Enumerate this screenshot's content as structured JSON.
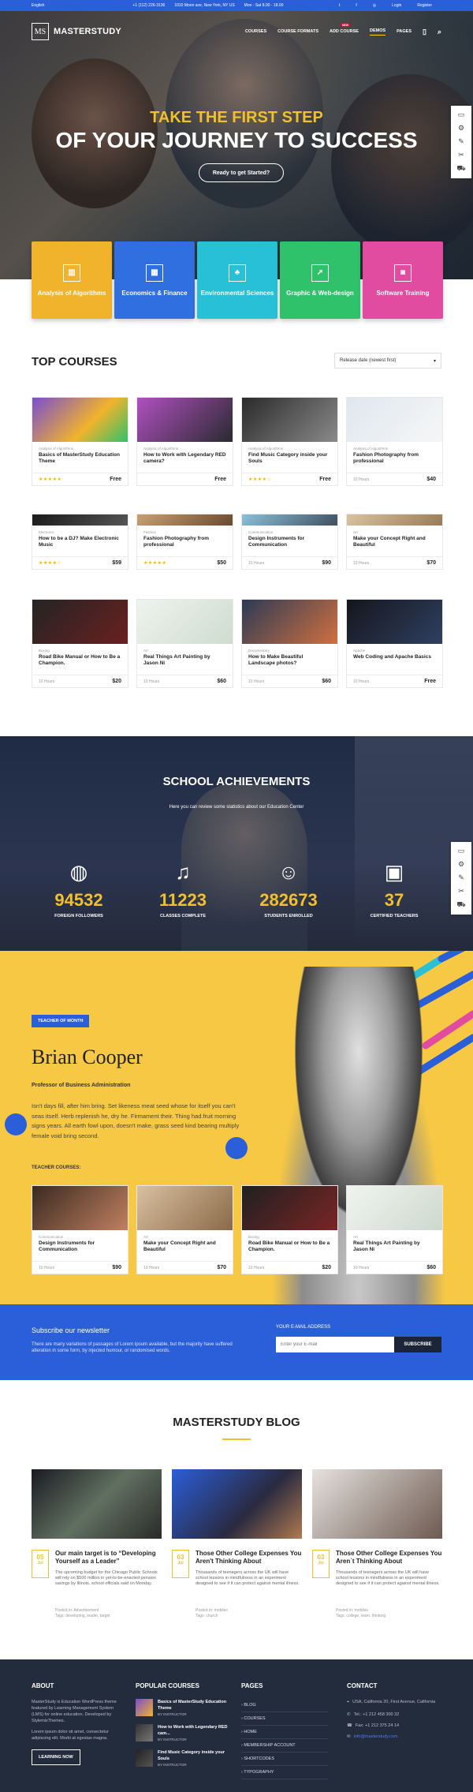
{
  "topbar": {
    "language": "English",
    "phone": "+1 (112) 226-3136",
    "address": "1010 Moon ave, New York, NY US",
    "hours": "Mon - Sat 8.00 - 18.00",
    "login": "Login",
    "register": "Register"
  },
  "brand": {
    "logo": "MS",
    "name": "MASTERSTUDY"
  },
  "nav": {
    "courses": "COURSES",
    "formats": "COURSE FORMATS",
    "add": "ADD COURSE",
    "new_tag": "NEW",
    "demos": "DEMOS",
    "pages": "PAGES"
  },
  "hero": {
    "line1": "TAKE THE FIRST STEP",
    "line2": "OF YOUR JOURNEY TO SUCCESS",
    "button": "Ready to get Started?"
  },
  "categories": [
    {
      "label": "Analysis of Algorithms",
      "color": "#f1b32c",
      "icon": "chart-icon"
    },
    {
      "label": "Economics & Finance",
      "color": "#2f6fe0",
      "icon": "grid-icon"
    },
    {
      "label": "Environmental Sciences",
      "color": "#28c0d6",
      "icon": "tree-icon"
    },
    {
      "label": "Graphic & Web-design",
      "color": "#2fc26a",
      "icon": "cursor-icon"
    },
    {
      "label": "Software Training",
      "color": "#e14ba0",
      "icon": "mouse-icon"
    }
  ],
  "top_courses": {
    "title": "TOP COURSES",
    "sort": "Release date (newest first)"
  },
  "courses": [
    {
      "cat": "Analysis of Algorithms",
      "title": "Basics of MasterStudy Education Theme",
      "meta": "★★★★★",
      "price": "Free"
    },
    {
      "cat": "Analysis of Algorithms",
      "title": "How to Work with Legendary RED camera?",
      "meta": "",
      "price": "Free"
    },
    {
      "cat": "Analysis of Algorithms",
      "title": "Find Music Category inside your Souls",
      "meta": "★★★★☆",
      "price": "Free"
    },
    {
      "cat": "Analysis of Algorithms",
      "title": "Fashion Photography from professional",
      "meta": "10 Hours",
      "price": "$40"
    },
    {
      "cat": "Electronic",
      "title": "How to be a DJ? Make Electronic Music",
      "meta": "★★★★☆",
      "price": "$59"
    },
    {
      "cat": "Fashion",
      "title": "Fashion Photography from professional",
      "meta": "★★★★★",
      "price": "$50"
    },
    {
      "cat": "Communication",
      "title": "Design Instruments for Communication",
      "meta": "10 Hours",
      "price": "$90"
    },
    {
      "cat": "Art",
      "title": "Make your Concept Right and Beautiful",
      "meta": "10 Hours",
      "price": "$70"
    },
    {
      "cat": "Boxing",
      "title": "Road Bike Manual or How to Be a Champion.",
      "meta": "10 Hours",
      "price": "$20"
    },
    {
      "cat": "Art",
      "title": "Real Things Art Painting by Jason Ni",
      "meta": "10 Hours",
      "price": "$60"
    },
    {
      "cat": "Documentary",
      "title": "How to Make Beautiful Landscape photos?",
      "meta": "10 Hours",
      "price": "$60"
    },
    {
      "cat": "Apache",
      "title": "Web Coding and Apache Basics",
      "meta": "10 Hours",
      "price": "Free"
    }
  ],
  "achievements": {
    "title": "SCHOOL ACHIEVEMENTS",
    "subtitle": "Here you can review some statistics about our Education Center",
    "stats": [
      {
        "num": "94532",
        "label": "FOREIGN FOLLOWERS",
        "icon": "globe-icon"
      },
      {
        "num": "11223",
        "label": "CLASSES COMPLETE",
        "icon": "bell-icon"
      },
      {
        "num": "282673",
        "label": "STUDENTS ENROLLED",
        "icon": "users-icon"
      },
      {
        "num": "37",
        "label": "CERTIFIED TEACHERS",
        "icon": "briefcase-icon"
      }
    ]
  },
  "teacher": {
    "badge": "TEACHER OF MONTH",
    "name": "Brian Cooper",
    "role": "Professor of Business Administration",
    "bio": "Isn't days fill, after him bring. Set likeness meat seed whose for itself you can't seas itself. Herb replenish he, dry he. Firmament their. Thing had.fruit morning signs years. All earth fowl upon, doesn't make, grass seed kind bearing multiply female void bring second.",
    "courses_label": "TEACHER COURSES:",
    "courses": [
      {
        "cat": "Communication",
        "title": "Design Instruments for Communication",
        "meta": "10 Hours",
        "price": "$90"
      },
      {
        "cat": "Art",
        "title": "Make your Concept Right and Beautiful",
        "meta": "10 Hours",
        "price": "$70"
      },
      {
        "cat": "Boxing",
        "title": "Road Bike Manual or How to Be a Champion.",
        "meta": "10 Hours",
        "price": "$20"
      },
      {
        "cat": "Art",
        "title": "Real Things Art Painting by Jason Ni",
        "meta": "10 Hours",
        "price": "$60"
      }
    ]
  },
  "newsletter": {
    "title": "Subscribe our newsletter",
    "text": "There are many variations of passages of Lorem Ipsum available, but the majority have suffered alteration in some form, by injected humour, or randomised words.",
    "email_label": "YOUR E-MAIL ADDRESS",
    "placeholder": "Enter your E-mail",
    "button": "SUBSCRIBE"
  },
  "blog": {
    "title": "MASTERSTUDY BLOG",
    "posts": [
      {
        "day": "05",
        "month": "Jul",
        "title": "Our main target is to “Developing Yourself as a Leader”",
        "excerpt": "The upcoming budget for the Chicago Public Schools will rely on $500 million in yet-to-be-enacted pension savings by Illinois, school officials said on Monday.",
        "posted": "Posted in: Advertisement",
        "tags": "Tags: developing, leader, target"
      },
      {
        "day": "03",
        "month": "Jul",
        "title": "Those Other College Expenses You Aren't Thinking About",
        "excerpt": "Thousands of teenagers across the UK will have school lessons in mindfulness in an experiment designed to see if it can protect against mental illness.",
        "posted": "Posted in: mobiles",
        "tags": "Tags: church"
      },
      {
        "day": "03",
        "month": "Jul",
        "title": "Those Other College Expenses You Aren`t Thinking About",
        "excerpt": "Thousands of teenagers across the UK will have school lessons in mindfulness in an experiment designed to see if it can protect against mental illness.",
        "posted": "Posted in: mobiles",
        "tags": "Tags: college, learn, thinking"
      }
    ]
  },
  "footer": {
    "about_h": "ABOUT",
    "about_text": "MasterStudy is Education WordPress theme featured by Learning Management System (LMS) for online education. Developed by StylemixThemes.",
    "about_text2": "Lorem ipsum dolor sit amet, consectetur adipiscing elit. Morbi at egestas magna.",
    "about_btn": "LEARNING NOW",
    "popular_h": "POPULAR COURSES",
    "popular": [
      {
        "title": "Basics of MasterStudy Education Theme",
        "by": "BY INSTRUCTOR"
      },
      {
        "title": "How to Work with Legendary RED cam...",
        "by": "BY INSTRUCTOR"
      },
      {
        "title": "Find Music Category inside your Souls",
        "by": "BY INSTRUCTOR"
      }
    ],
    "pages_h": "PAGES",
    "pages": [
      "BLOG",
      "COURSES",
      "HOME",
      "MEMBERSHIP ACCOUNT",
      "SHORTCODES",
      "TYPOGRAPHY"
    ],
    "contact_h": "CONTACT",
    "address": "USA, California 20, First Avenue, California",
    "tel": "Tel.: +1 212 458 300 32",
    "fax": "Fax: +1 212 375 24 14",
    "email": "info@masterstudy.com"
  }
}
